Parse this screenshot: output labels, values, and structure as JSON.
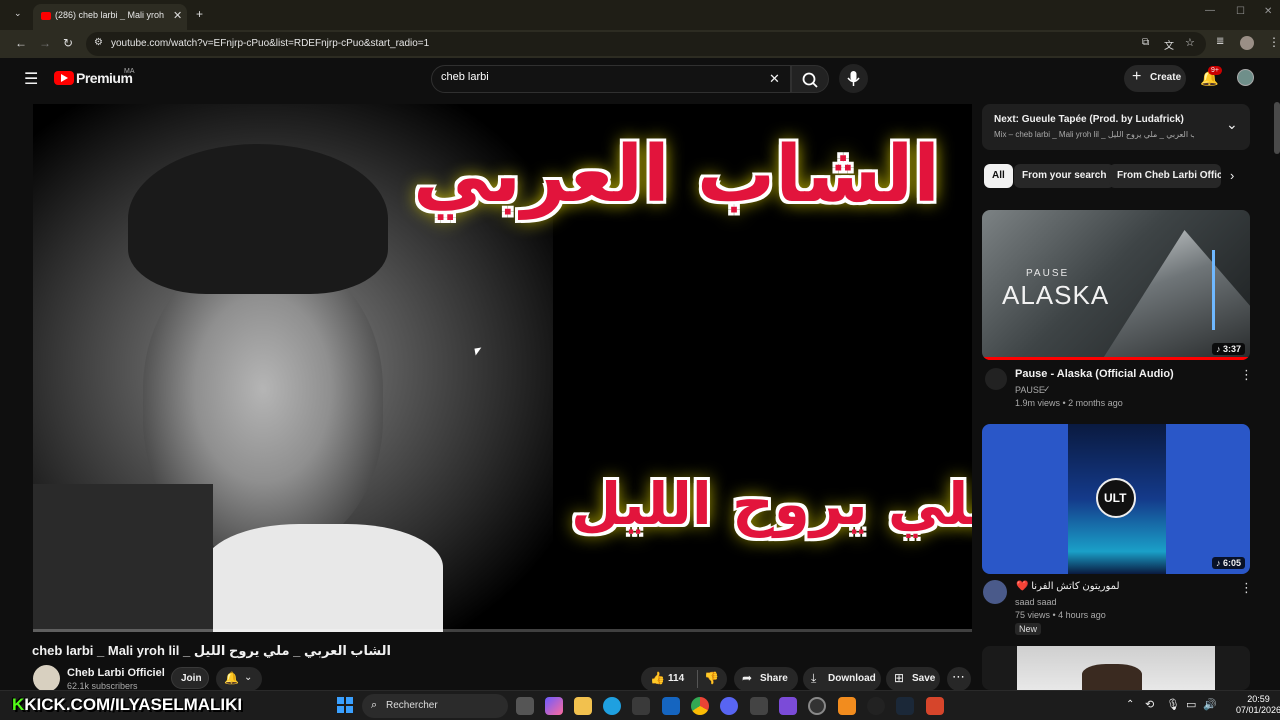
{
  "browser": {
    "tab_title": "(286) cheb larbi _ Mali yroh",
    "url": "youtube.com/watch?v=EFnjrp-cPuo&list=RDEFnjrp-cPuo&start_radio=1"
  },
  "header": {
    "logo_label": "Premium",
    "logo_region": "MA",
    "search_value": "cheb larbi",
    "create_label": "Create",
    "notifications_badge": "9+"
  },
  "video": {
    "overlay_title_ar": "الشاب العربي",
    "overlay_subtitle_ar": "ملي يروح الليل",
    "progress": 0.0,
    "title": "cheb larbi _ Mali yroh lil _ الشاب العربي _ ملي يروح الليل",
    "channel": "Cheb Larbi Officiel",
    "subscribers": "62.1k subscribers",
    "join_label": "Join",
    "likes": "114",
    "share_label": "Share",
    "download_label": "Download",
    "save_label": "Save"
  },
  "next": {
    "label": "Next: Gueule Tapée (Prod. by Ludafrick)",
    "mix": "Mix – cheb larbi _ Mali yroh lil _ الشاب العربي _ ملي يروح الليل"
  },
  "chips": [
    "All",
    "From your search",
    "From Cheb Larbi Offici"
  ],
  "recommendations": [
    {
      "thumb_text_1": "PAUSE",
      "thumb_text_2": "ALASKA",
      "duration": "3:37",
      "title": "Pause - Alaska (Official Audio)",
      "channel": "PAUSE",
      "meta": "1.9m views • 2 months ago"
    },
    {
      "thumb_text_1": "ULT",
      "duration": "6:05",
      "title": "❤️ لموريتون كاتش الفرنا",
      "channel": "saad saad",
      "meta": "75 views • 4 hours ago",
      "badge": "New"
    }
  ],
  "taskbar": {
    "kick_text": "KICK.COM/ILYASELMALIKI",
    "search_label": "Rechercher",
    "time": "20:59",
    "date": "07/01/2026"
  }
}
